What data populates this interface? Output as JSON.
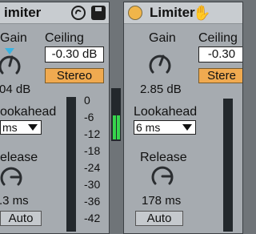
{
  "left_device": {
    "title": "imiter",
    "gain": {
      "label": "Gain",
      "value": "04 dB"
    },
    "ceiling": {
      "label": "Ceiling",
      "value": "-0.30 dB"
    },
    "stereo_label": "Stereo",
    "lookahead": {
      "label": "ookahead",
      "value": "ms"
    },
    "release": {
      "label": "elease",
      "value": ".3 ms"
    },
    "auto_label": "Auto",
    "meter_scale": [
      "0",
      "-6",
      "-12",
      "-18",
      "-24",
      "-30",
      "-36",
      "-42"
    ]
  },
  "right_device": {
    "title": "Limiter",
    "gain": {
      "label": "Gain",
      "value": "2.85 dB"
    },
    "ceiling": {
      "label": "Ceiling",
      "value": "-0.30"
    },
    "stereo_label": "Stere",
    "lookahead": {
      "label": "Lookahead",
      "value": "6 ms"
    },
    "release": {
      "label": "Release",
      "value": "178 ms"
    },
    "auto_label": "Auto"
  },
  "colors": {
    "accent": "#f0aa50",
    "power_on": "#f0b54a",
    "meter_green": "#37d44d",
    "hand_icon": "#4a55e8"
  }
}
